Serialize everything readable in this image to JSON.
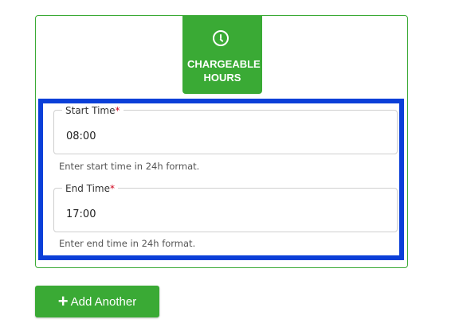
{
  "badge": {
    "icon": "clock-icon",
    "label": "Chargeable Hours",
    "color": "#3aaa35"
  },
  "highlight_color": "#0b3fd8",
  "fields": [
    {
      "label": "Start Time",
      "required_marker": "*",
      "value": "08:00",
      "hint": "Enter start time in 24h format."
    },
    {
      "label": "End Time",
      "required_marker": "*",
      "value": "17:00",
      "hint": "Enter end time in 24h format."
    }
  ],
  "add_button": {
    "icon": "plus-icon",
    "label": "Add Another"
  }
}
